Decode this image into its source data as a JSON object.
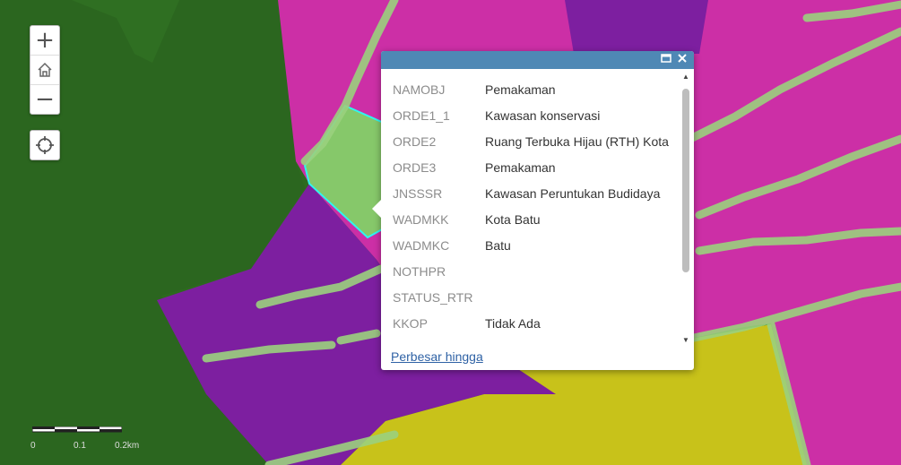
{
  "map": {
    "colors": {
      "forest": "#2d6a1f",
      "conservation_zone": "#cc2fa6",
      "cultivation_zone": "#7d1fa0",
      "agriculture_zone": "#c8c21a",
      "road": "#9bd17e",
      "selected_fill": "#86c86a",
      "selected_outline": "#2ff5f0"
    }
  },
  "controls": {
    "zoom_in": "+",
    "home_icon": "home-icon",
    "zoom_out": "−",
    "locate_icon": "locate-icon"
  },
  "popup": {
    "header_color": "#4f88b5",
    "maximize_icon": "maximize-icon",
    "close_icon": "close-icon",
    "attributes": [
      {
        "key": "NAMOBJ",
        "value": "Pemakaman"
      },
      {
        "key": "ORDE1_1",
        "value": "Kawasan konservasi"
      },
      {
        "key": "ORDE2",
        "value": "Ruang Terbuka Hijau (RTH) Kota"
      },
      {
        "key": "ORDE3",
        "value": "Pemakaman"
      },
      {
        "key": "JNSSSR",
        "value": "Kawasan Peruntukan Budidaya"
      },
      {
        "key": "WADMKK",
        "value": "Kota Batu"
      },
      {
        "key": "WADMKC",
        "value": "Batu"
      },
      {
        "key": "NOTHPR",
        "value": ""
      },
      {
        "key": "STATUS_RTR",
        "value": ""
      },
      {
        "key": "KKOP",
        "value": "Tidak Ada"
      }
    ],
    "zoom_link": "Perbesar hingga"
  },
  "scalebar": {
    "labels": [
      "0",
      "0.1",
      "0.2km"
    ]
  }
}
